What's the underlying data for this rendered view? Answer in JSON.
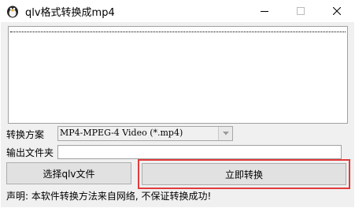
{
  "window": {
    "title": "qlv格式转换成mp4",
    "icons": {
      "app": "penguin-app-icon",
      "minimize": "minimize-icon",
      "maximize": "maximize-icon",
      "close": "close-icon"
    }
  },
  "form": {
    "format_label": "转换方案",
    "format_value": "MP4-MPEG-4 Video (*.mp4)",
    "output_label": "输出文件夹",
    "output_value": ""
  },
  "buttons": {
    "select": "选择qlv文件",
    "convert": "立即转换"
  },
  "notice": "声明: 本软件转换方法来自网络, 不保证转换成功!",
  "colors": {
    "highlight_border": "#e23b3b",
    "button_face": "#e1e1e1"
  }
}
